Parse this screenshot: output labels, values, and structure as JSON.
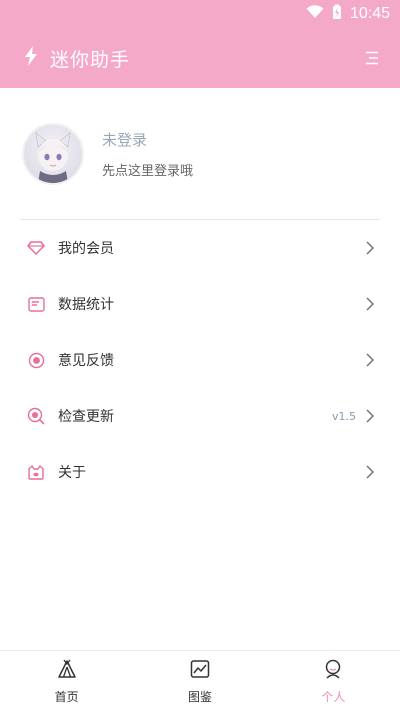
{
  "status_bar": {
    "time": "10:45"
  },
  "app_bar": {
    "title": "迷你助手"
  },
  "profile": {
    "name": "未登录",
    "hint": "先点这里登录哦"
  },
  "menu": [
    {
      "label": "我的会员",
      "icon": "diamond-icon",
      "extra": ""
    },
    {
      "label": "数据统计",
      "icon": "chart-card-icon",
      "extra": ""
    },
    {
      "label": "意见反馈",
      "icon": "feedback-icon",
      "extra": ""
    },
    {
      "label": "检查更新",
      "icon": "search-update-icon",
      "extra": "v1.5"
    },
    {
      "label": "关于",
      "icon": "about-icon",
      "extra": ""
    }
  ],
  "bottom_nav": [
    {
      "label": "首页",
      "icon": "tent-icon",
      "active": false
    },
    {
      "label": "图鉴",
      "icon": "gallery-icon",
      "active": false
    },
    {
      "label": "个人",
      "icon": "person-icon",
      "active": true
    }
  ],
  "colors": {
    "accent": "#f4a9c9",
    "active": "#f08cb6",
    "icon_pink": "#e86f97"
  }
}
